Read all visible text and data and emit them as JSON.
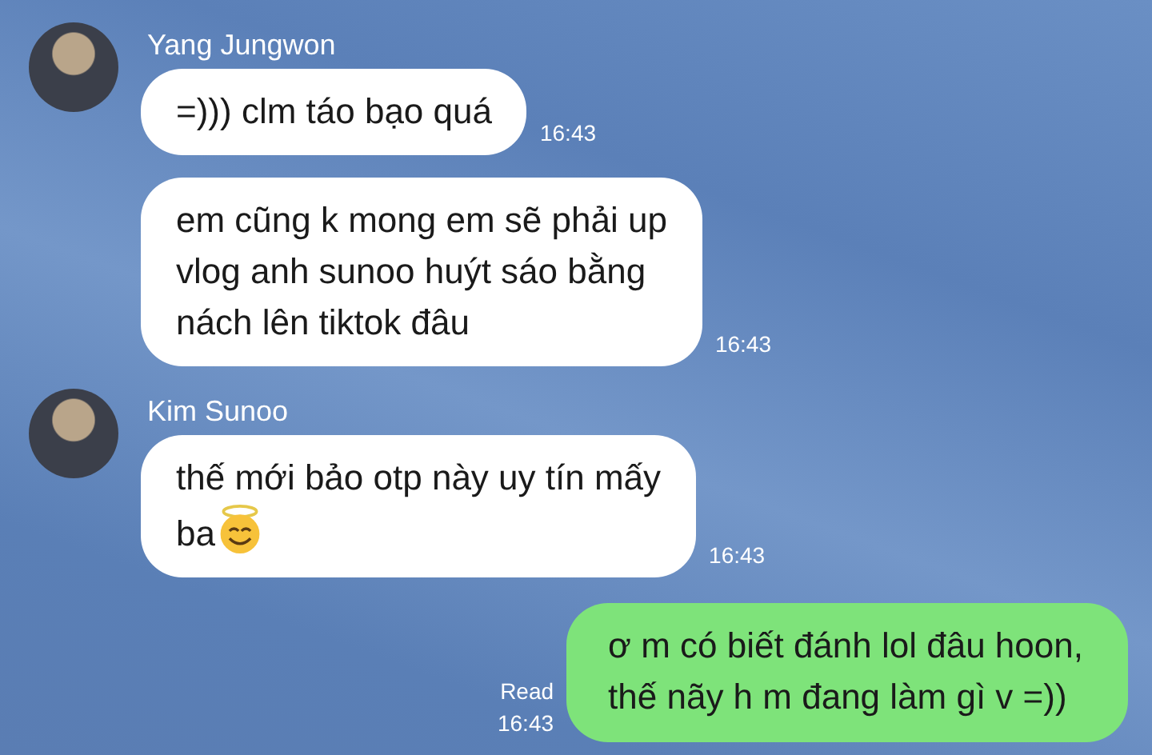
{
  "messages": [
    {
      "kind": "incoming",
      "sender": "Yang Jungwon",
      "lines": [
        "=))) clm táo bạo quá"
      ],
      "time": "16:43"
    },
    {
      "kind": "incoming",
      "lines": [
        "em cũng k mong em sẽ phải up",
        "vlog anh sunoo huýt sáo bằng",
        "nách lên tiktok đâu"
      ],
      "time": "16:43"
    },
    {
      "kind": "incoming",
      "sender": "Kim Sunoo",
      "lines": [
        "thế mới bảo otp này uy tín mấy",
        "ba"
      ],
      "emoji": true,
      "time": "16:43"
    },
    {
      "kind": "outgoing",
      "lines": [
        "ơ m có biết đánh lol đâu hoon,",
        "thế nãy h m đang làm gì v =))"
      ],
      "read": "Read",
      "time": "16:43"
    }
  ]
}
